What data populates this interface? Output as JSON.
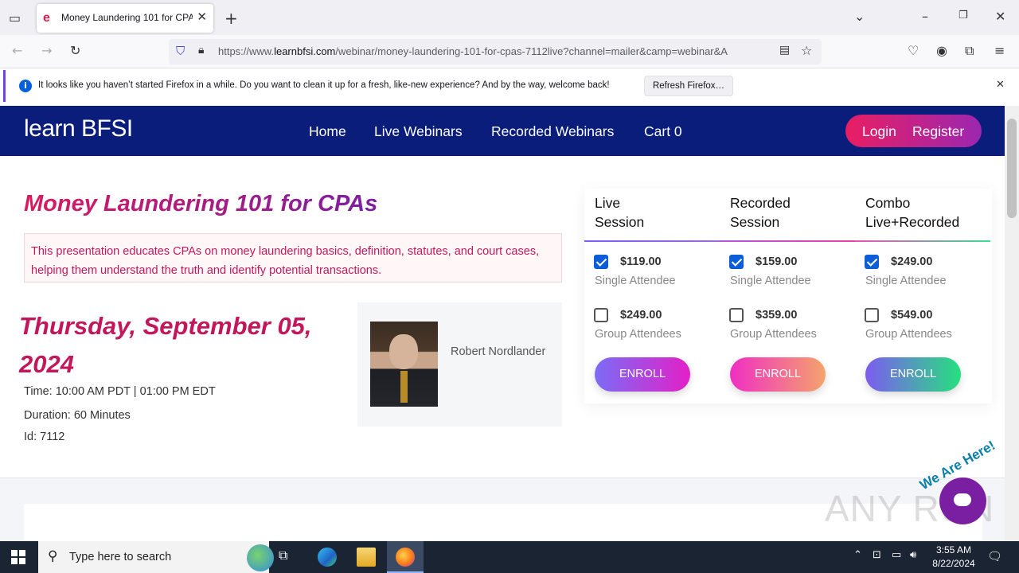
{
  "browser": {
    "tab_title": "Money Laundering 101 for CPA",
    "favicon_text": "e",
    "url_prefix": "https://www.",
    "url_domain": "learnbfsi.com",
    "url_path": "/webinar/money-laundering-101-for-cpas-7112live?channel=mailer&camp=webinar&A",
    "notification_text": "It looks like you haven’t started Firefox in a while. Do you want to clean it up for a fresh, like-new experience? And by the way, welcome back!",
    "notification_button": "Refresh Firefox…"
  },
  "site": {
    "logo": "learn BFSI",
    "nav": [
      "Home",
      "Live Webinars",
      "Recorded Webinars",
      "Cart 0"
    ],
    "login": "Login",
    "register": "Register"
  },
  "course": {
    "title": "Money Laundering 101 for CPAs",
    "description": "This presentation educates CPAs on money laundering basics, definition, statutes, and court cases, helping them understand the truth and identify potential transactions.",
    "date": "Thursday, September 05, 2024",
    "time": "Time: 10:00 AM PDT | 01:00 PM EDT",
    "duration": "Duration: 60 Minutes",
    "id": "Id: 7112",
    "speaker": "Robert Nordlander"
  },
  "pricing": [
    {
      "heading": "Live Session",
      "options": [
        {
          "price": "$119.00",
          "type": "Single Attendee",
          "checked": true
        },
        {
          "price": "$249.00",
          "type": "Group Attendees",
          "checked": false
        }
      ],
      "button": "ENROLL"
    },
    {
      "heading": "Recorded Session",
      "options": [
        {
          "price": "$159.00",
          "type": "Single Attendee",
          "checked": true
        },
        {
          "price": "$359.00",
          "type": "Group Attendees",
          "checked": false
        }
      ],
      "button": "ENROLL"
    },
    {
      "heading": "Combo Live+Recorded",
      "options": [
        {
          "price": "$249.00",
          "type": "Single Attendee",
          "checked": true
        },
        {
          "price": "$549.00",
          "type": "Group Attendees",
          "checked": false
        }
      ],
      "button": "ENROLL"
    }
  ],
  "widgets": {
    "chat_label": "We Are Here!",
    "watermark": "ANY RUN"
  },
  "taskbar": {
    "search_placeholder": "Type here to search",
    "time": "3:55 AM",
    "date": "8/22/2024"
  },
  "colors": {
    "header_bg": "#0a1d7a",
    "accent_pink": "#c2185b",
    "auth_gradient": [
      "#e91e63",
      "#9c27b0"
    ]
  }
}
